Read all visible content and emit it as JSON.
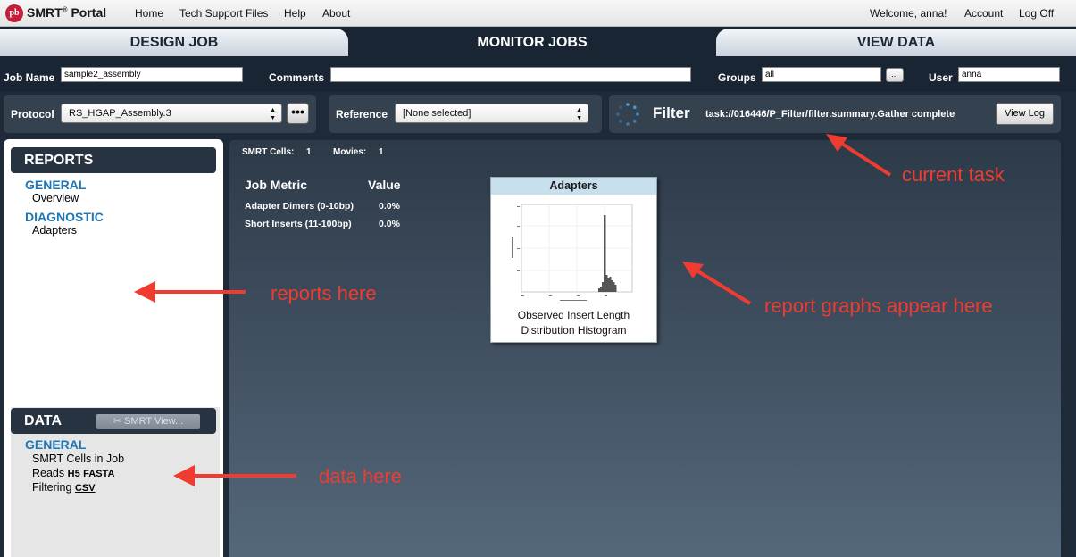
{
  "topbar": {
    "brand": "SMRT",
    "brand_reg": "®",
    "brand_suffix": "Portal",
    "logo_glyph": "pb",
    "menu": [
      "Home",
      "Tech Support Files",
      "Help",
      "About"
    ],
    "welcome": "Welcome, anna!",
    "account": "Account",
    "logout": "Log Off"
  },
  "tabs": [
    "DESIGN JOB",
    "MONITOR JOBS",
    "VIEW DATA"
  ],
  "jobrow": {
    "job_name_label": "Job Name",
    "job_name_value": "sample2_assembly",
    "comments_label": "Comments",
    "comments_value": "",
    "groups_label": "Groups",
    "groups_value": "all",
    "groups_btn": "...",
    "user_label": "User",
    "user_value": "anna"
  },
  "config": {
    "protocol_label": "Protocol",
    "protocol_value": "RS_HGAP_Assembly.3",
    "protocol_btn": "•••",
    "reference_label": "Reference",
    "reference_value": "[None selected]",
    "filter_title": "Filter",
    "task": "task://016446/P_Filter/filter.summary.Gather complete",
    "view_log": "View Log"
  },
  "reports": {
    "header": "REPORTS",
    "general": "GENERAL",
    "overview": "Overview",
    "diagnostic": "DIAGNOSTIC",
    "adapters": "Adapters"
  },
  "data_panel": {
    "header": "DATA",
    "smrt_view": "SMRT View...",
    "general": "GENERAL",
    "cells": "SMRT Cells in Job",
    "reads": "Reads",
    "reads_h5": "H5",
    "reads_fasta": "FASTA",
    "filtering": "Filtering",
    "filtering_csv": "CSV"
  },
  "content": {
    "smrt_cells_label": "SMRT Cells:",
    "smrt_cells_value": "1",
    "movies_label": "Movies:",
    "movies_value": "1",
    "metric_col": "Job Metric",
    "value_col": "Value",
    "rows": [
      {
        "metric": "Adapter Dimers (0-10bp)",
        "value": "0.0%"
      },
      {
        "metric": "Short Inserts (11-100bp)",
        "value": "0.0%"
      }
    ],
    "card_title": "Adapters",
    "card_caption": "Observed Insert Length Distribution Histogram"
  },
  "annotations": {
    "current_task": "current task",
    "reports_here": "reports here",
    "graphs_here": "report graphs appear here",
    "data_here": "data here"
  },
  "colors": {
    "accent_red": "#f03c30",
    "section_blue": "#1f77b4",
    "dark_navy": "#1a2533"
  },
  "icons": [
    "logo-icon",
    "spinner-icon",
    "wrench-icon",
    "dropdown-arrows-icon"
  ]
}
